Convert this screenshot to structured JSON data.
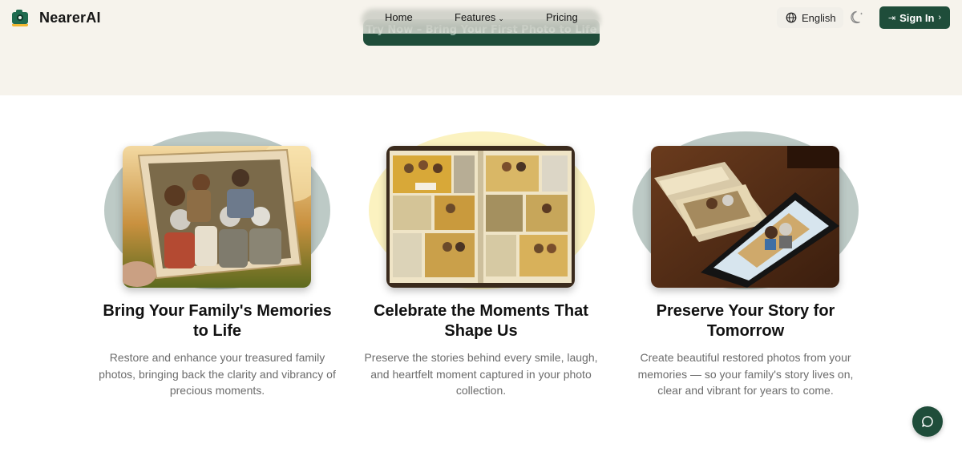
{
  "brand": {
    "name": "NearerAI",
    "logo_icon": "camera-icon"
  },
  "nav": {
    "home": "Home",
    "features": "Features",
    "pricing": "Pricing"
  },
  "header": {
    "language": "English",
    "theme_icon": "moon-icon",
    "signin": "Sign In"
  },
  "hero": {
    "cta": "Try Now – Bring Your First Photo to Life"
  },
  "features": [
    {
      "title": "Bring Your Family's Memories to Life",
      "description": "Restore and enhance your treasured family photos, bringing back the clarity and vibrancy of precious moments.",
      "accent": "#bdcac6"
    },
    {
      "title": "Celebrate the Moments That Shape Us",
      "description": "Preserve the stories behind every smile, laugh, and heartfelt moment captured in your photo collection.",
      "accent": "#fbf2c0"
    },
    {
      "title": "Preserve Your Story for Tomorrow",
      "description": "Create beautiful restored photos from your memories — so your family's story lives on, clear and vibrant for years to come.",
      "accent": "#bdcac6"
    }
  ],
  "colors": {
    "brand_green": "#1f4d3a",
    "hero_bg": "#f6f3ec",
    "text_muted": "#6c6c6c"
  },
  "chat": {
    "icon": "chat-bubble-icon"
  }
}
